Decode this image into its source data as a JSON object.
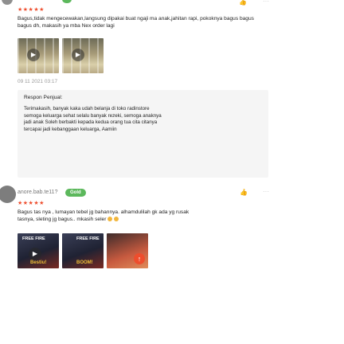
{
  "reviews": [
    {
      "username": "",
      "badge": "",
      "stars": "★★★★★",
      "text": "Bagus,tidak mengecewakan,langsung dipakai buat ngaji ma anak,jahitan rapi, pokoknya bagus bagus bagus dh, makasih ya mba Nex order lagi",
      "date": "09 11 2021 03:17",
      "media": [
        {
          "type": "video",
          "play_icon": "▶"
        },
        {
          "type": "video",
          "play_icon": "▶"
        }
      ],
      "seller_response": {
        "title": "Respon Penjual:",
        "text": "Terimakasih, banyak kaka udah belanja di toko radinstore semoga keluarga sehat selalu banyak rezeki, semoga anaknya jadi anak Soleh berbakti kepada kedua orang tua cita citanya tercapai jadi kebanggaan keluarga, Aamiin"
      }
    },
    {
      "username": "anore.bab.te11?",
      "badge": "Gold",
      "like_icon": "👍",
      "more_icon": "···",
      "stars": "★★★★★",
      "text": "Bagus tas nya , lumayan tebel jg bahannya. alhamdulilah gk ada yg rusak tasnya, sleting jg bagus.. mkasih seler",
      "media": [
        {
          "type": "video",
          "label": "FREE FIRE",
          "play_icon": "▶",
          "tag": "Bestiu!"
        },
        {
          "type": "image",
          "label": "FREE FIRE",
          "tag": "BOOM!"
        },
        {
          "type": "image",
          "upload_icon": "↑"
        }
      ]
    }
  ],
  "colors": {
    "accent": "#ee4d2d",
    "badge": "#5cb85c",
    "panel": "#f5f5f5"
  }
}
